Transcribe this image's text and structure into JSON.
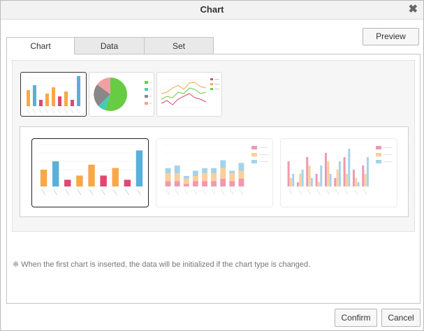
{
  "dialog": {
    "title": "Chart",
    "close_symbol": "✖",
    "preview_label": "Preview",
    "confirm_label": "Confirm",
    "cancel_label": "Cancel"
  },
  "tabs": [
    {
      "label": "Chart",
      "active": true
    },
    {
      "label": "Data",
      "active": false
    },
    {
      "label": "Set",
      "active": false
    }
  ],
  "chart_types": [
    {
      "name": "bar",
      "selected": true
    },
    {
      "name": "pie",
      "selected": false
    },
    {
      "name": "line",
      "selected": false
    }
  ],
  "chart_subtypes": [
    {
      "name": "basic-bar",
      "selected": true
    },
    {
      "name": "stacked-bar",
      "selected": false
    },
    {
      "name": "grouped-bar",
      "selected": false
    }
  ],
  "note": "※ When the first chart is inserted, the data will be initialized if the chart type is changed.",
  "colors": {
    "orange": "#f8a848",
    "blue": "#5ab0d8",
    "pink": "#e04870",
    "green": "#66cc44",
    "gray": "#888888",
    "salmon": "#f0a0a0",
    "teal": "#44ccbb"
  },
  "chart_data": [
    {
      "type": "bar",
      "id": "basic-bar-preview",
      "values": [
        4,
        6,
        1.6,
        2.6,
        5.2,
        2.6,
        4.4,
        1.6,
        8.6
      ],
      "bar_colors": [
        "#f8a848",
        "#5ab0d8",
        "#e04870",
        "#f8a848",
        "#f8a848",
        "#e04870",
        "#f8a848",
        "#e04870",
        "#5ab0d8"
      ],
      "ylim": [
        0,
        10
      ]
    },
    {
      "type": "bar",
      "stacked": true,
      "id": "stacked-bar-preview",
      "series": [
        {
          "values": [
            2,
            2,
            1,
            2,
            2,
            2,
            3,
            2,
            3
          ]
        },
        {
          "values": [
            3,
            3,
            2,
            2,
            3,
            3,
            4,
            3,
            3
          ]
        },
        {
          "values": [
            2,
            3,
            1,
            2,
            2,
            2,
            3,
            1,
            3
          ]
        }
      ],
      "series_colors": [
        "#e04870",
        "#f8a848",
        "#5ab0d8"
      ],
      "ylim": [
        0,
        16
      ]
    },
    {
      "type": "bar",
      "id": "grouped-bar-preview",
      "series": [
        {
          "values": [
            6,
            1,
            7,
            3,
            8,
            2,
            7,
            4,
            5
          ]
        },
        {
          "values": [
            2,
            3,
            5,
            1,
            6,
            4,
            3,
            2,
            3
          ]
        },
        {
          "values": [
            3,
            4,
            2,
            5,
            3,
            6,
            9,
            1,
            7
          ]
        }
      ],
      "series_colors": [
        "#e04870",
        "#f8a848",
        "#5ab0d8"
      ],
      "ylim": [
        0,
        10
      ]
    }
  ]
}
